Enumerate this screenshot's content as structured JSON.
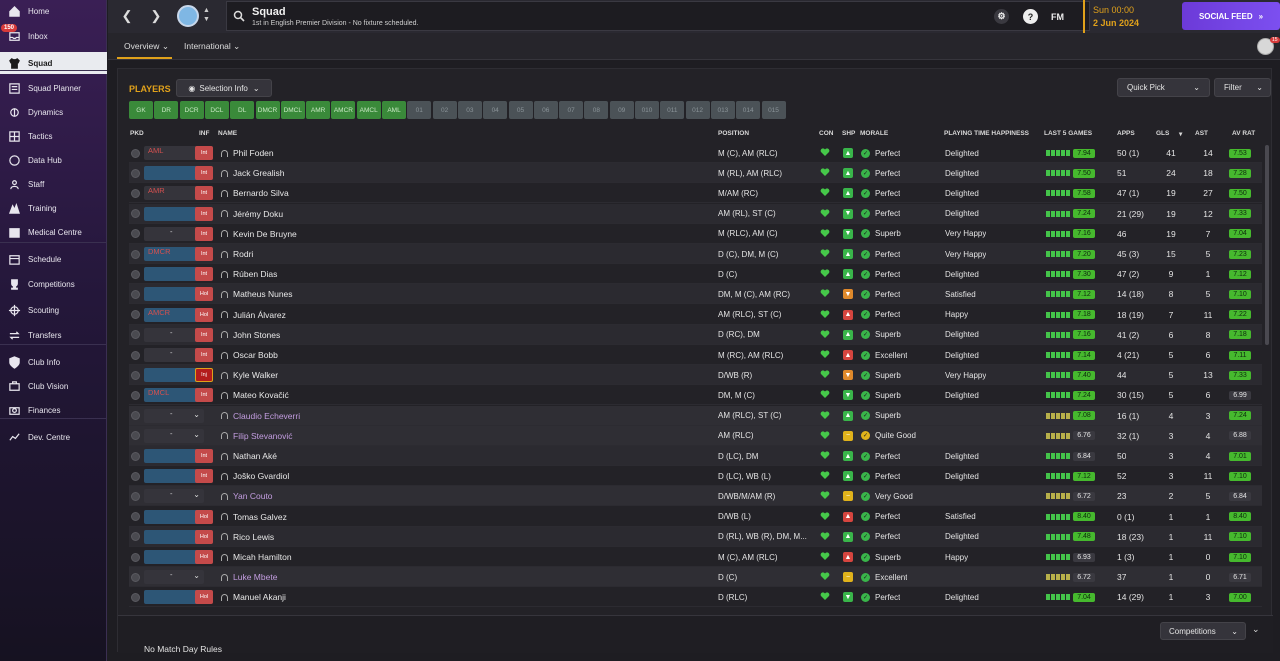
{
  "sidebar": {
    "items": [
      {
        "label": "Home",
        "icon": "home-icon"
      },
      {
        "label": "Inbox",
        "icon": "inbox-icon",
        "badge": "150"
      },
      {
        "label": "Squad",
        "icon": "shirt-icon",
        "active": true
      },
      {
        "label": "Squad Planner",
        "icon": "planner-icon"
      },
      {
        "label": "Dynamics",
        "icon": "dynamics-icon"
      },
      {
        "label": "Tactics",
        "icon": "tactics-icon"
      },
      {
        "label": "Data Hub",
        "icon": "datahub-icon"
      },
      {
        "label": "Staff",
        "icon": "staff-icon"
      },
      {
        "label": "Training",
        "icon": "training-icon"
      },
      {
        "label": "Medical Centre",
        "icon": "medical-icon"
      },
      {
        "label": "Schedule",
        "icon": "calendar-icon"
      },
      {
        "label": "Competitions",
        "icon": "trophy-icon"
      },
      {
        "label": "Scouting",
        "icon": "scouting-icon"
      },
      {
        "label": "Transfers",
        "icon": "transfers-icon"
      },
      {
        "label": "Club Info",
        "icon": "shield-icon"
      },
      {
        "label": "Club Vision",
        "icon": "vision-icon"
      },
      {
        "label": "Finances",
        "icon": "finances-icon"
      },
      {
        "label": "Dev. Centre",
        "icon": "devcentre-icon"
      }
    ]
  },
  "header": {
    "title": "Squad",
    "subtitle": "1st in English Premier Division - No fixture scheduled.",
    "fm_label": "FM",
    "help_label": "?",
    "date_day": "Sun 00:00",
    "date": "2 Jun 2024",
    "social_feed": "SOCIAL FEED",
    "avatar_badge": "15"
  },
  "tabs": [
    {
      "label": "Overview"
    },
    {
      "label": "International"
    }
  ],
  "players_panel": {
    "title": "PLAYERS",
    "selection_info": "Selection Info",
    "quick_pick": "Quick Pick",
    "filter": "Filter",
    "position_filters_on": [
      "GK",
      "DR",
      "DCR",
      "DCL",
      "DL",
      "DMCR",
      "DMCL",
      "AMR",
      "AMCR",
      "AMCL",
      "AML"
    ],
    "position_filters_off": [
      "01",
      "02",
      "03",
      "04",
      "05",
      "06",
      "07",
      "08",
      "09",
      "010",
      "011",
      "012",
      "013",
      "014",
      "015"
    ]
  },
  "columns": {
    "pkd": "PKD",
    "inf": "INF",
    "name": "NAME",
    "position": "POSITION",
    "con": "CON",
    "shp": "SHP",
    "morale": "MORALE",
    "pth": "PLAYING TIME HAPPINESS",
    "last5": "LAST 5 GAMES",
    "apps": "APPS",
    "gls": "GLS",
    "ast": "AST",
    "avrat": "AV RAT"
  },
  "colors": {
    "accent": "#e0a11b",
    "green": "#39b54a",
    "rating_green": "#46b92e",
    "youth_name": "#c39de0"
  },
  "players": [
    {
      "pkd": "AML",
      "inf": "Int",
      "name": "Phil Foden",
      "position": "M (C), AM (RLC)",
      "shp": "up",
      "morale": "Perfect",
      "happiness": "Delighted",
      "last5": "7.94",
      "apps": "50 (1)",
      "gls": "41",
      "ast": "14",
      "avrat": "7.53",
      "youth": false
    },
    {
      "pkd": "",
      "inf": "Int",
      "name": "Jack Grealish",
      "position": "M (RL), AM (RLC)",
      "shp": "up",
      "morale": "Perfect",
      "happiness": "Delighted",
      "last5": "7.50",
      "apps": "51",
      "gls": "24",
      "ast": "18",
      "avrat": "7.28",
      "youth": false
    },
    {
      "pkd": "AMR",
      "inf": "Int",
      "name": "Bernardo Silva",
      "position": "M/AM (RC)",
      "shp": "up",
      "morale": "Perfect",
      "happiness": "Delighted",
      "last5": "7.58",
      "apps": "47 (1)",
      "gls": "19",
      "ast": "27",
      "avrat": "7.50",
      "youth": false
    },
    {
      "pkd": "",
      "inf": "Int",
      "name": "Jérémy Doku",
      "position": "AM (RL), ST (C)",
      "shp": "down",
      "morale": "Perfect",
      "happiness": "Delighted",
      "last5": "7.24",
      "apps": "21 (29)",
      "gls": "19",
      "ast": "12",
      "avrat": "7.33",
      "youth": false
    },
    {
      "pkd": "-",
      "inf": "Int",
      "name": "Kevin De Bruyne",
      "position": "M (RLC), AM (C)",
      "shp": "down",
      "morale": "Superb",
      "happiness": "Very Happy",
      "last5": "7.16",
      "apps": "46",
      "gls": "19",
      "ast": "7",
      "avrat": "7.04",
      "youth": false
    },
    {
      "pkd": "DMCR",
      "inf": "Int",
      "name": "Rodri",
      "position": "D (C), DM, M (C)",
      "shp": "up",
      "morale": "Perfect",
      "happiness": "Very Happy",
      "last5": "7.20",
      "apps": "45 (3)",
      "gls": "15",
      "ast": "5",
      "avrat": "7.23",
      "youth": false
    },
    {
      "pkd": "",
      "inf": "Int",
      "name": "Rúben Dias",
      "position": "D (C)",
      "shp": "up",
      "morale": "Perfect",
      "happiness": "Delighted",
      "last5": "7.30",
      "apps": "47 (2)",
      "gls": "9",
      "ast": "1",
      "avrat": "7.12",
      "youth": false
    },
    {
      "pkd": "",
      "inf": "Hol",
      "name": "Matheus Nunes",
      "position": "DM, M (C), AM (RC)",
      "shp": "mid",
      "morale": "Perfect",
      "happiness": "Satisfied",
      "last5": "7.12",
      "apps": "14 (18)",
      "gls": "8",
      "ast": "5",
      "avrat": "7.10",
      "youth": false
    },
    {
      "pkd": "AMCR",
      "inf": "Hol",
      "name": "Julián Álvarez",
      "position": "AM (RLC), ST (C)",
      "shp": "injury",
      "morale": "Perfect",
      "happiness": "Happy",
      "last5": "7.18",
      "apps": "18 (19)",
      "gls": "7",
      "ast": "11",
      "avrat": "7.22",
      "youth": false
    },
    {
      "pkd": "-",
      "inf": "Int",
      "name": "John Stones",
      "position": "D (RC), DM",
      "shp": "up",
      "morale": "Superb",
      "happiness": "Delighted",
      "last5": "7.16",
      "apps": "41 (2)",
      "gls": "6",
      "ast": "8",
      "avrat": "7.18",
      "youth": false
    },
    {
      "pkd": "-",
      "inf": "Int",
      "name": "Oscar Bobb",
      "position": "M (RC), AM (RLC)",
      "shp": "injury",
      "morale": "Excellent",
      "happiness": "Delighted",
      "last5": "7.14",
      "apps": "4 (21)",
      "gls": "5",
      "ast": "6",
      "avrat": "7.11",
      "youth": false
    },
    {
      "pkd": "",
      "inf": "Inj",
      "name": "Kyle Walker",
      "position": "D/WB (R)",
      "shp": "mid",
      "morale": "Superb",
      "happiness": "Very Happy",
      "last5": "7.40",
      "apps": "44",
      "gls": "5",
      "ast": "13",
      "avrat": "7.33",
      "youth": false
    },
    {
      "pkd": "DMCL",
      "inf": "Int",
      "name": "Mateo Kovačić",
      "position": "DM, M (C)",
      "shp": "down",
      "morale": "Superb",
      "happiness": "Delighted",
      "last5": "7.24",
      "apps": "30 (15)",
      "gls": "5",
      "ast": "6",
      "avrat": "6.99",
      "youth": false
    },
    {
      "pkd": "-",
      "inf": "",
      "name": "Claudio Echeverri",
      "position": "AM (RLC), ST (C)",
      "shp": "up",
      "morale": "Superb",
      "happiness": "",
      "last5": "7.08",
      "apps": "16 (1)",
      "gls": "4",
      "ast": "3",
      "avrat": "7.24",
      "youth": true
    },
    {
      "pkd": "-",
      "inf": "",
      "name": "Filip Stevanović",
      "position": "AM (RLC)",
      "shp": "neutral",
      "morale": "Quite Good",
      "happiness": "",
      "last5": "6.76",
      "apps": "32 (1)",
      "gls": "3",
      "ast": "4",
      "avrat": "6.88",
      "youth": true
    },
    {
      "pkd": "",
      "inf": "Int",
      "name": "Nathan Aké",
      "position": "D (LC), DM",
      "shp": "up",
      "morale": "Perfect",
      "happiness": "Delighted",
      "last5": "6.84",
      "apps": "50",
      "gls": "3",
      "ast": "4",
      "avrat": "7.01",
      "youth": false
    },
    {
      "pkd": "",
      "inf": "Int",
      "name": "Joško Gvardiol",
      "position": "D (LC), WB (L)",
      "shp": "up",
      "morale": "Perfect",
      "happiness": "Delighted",
      "last5": "7.12",
      "apps": "52",
      "gls": "3",
      "ast": "11",
      "avrat": "7.10",
      "youth": false
    },
    {
      "pkd": "-",
      "inf": "",
      "name": "Yan Couto",
      "position": "D/WB/M/AM (R)",
      "shp": "neutral",
      "morale": "Very Good",
      "happiness": "",
      "last5": "6.72",
      "apps": "23",
      "gls": "2",
      "ast": "5",
      "avrat": "6.84",
      "youth": true
    },
    {
      "pkd": "",
      "inf": "Hol",
      "name": "Tomas Galvez",
      "position": "D/WB (L)",
      "shp": "injury",
      "morale": "Perfect",
      "happiness": "Satisfied",
      "last5": "8.40",
      "apps": "0 (1)",
      "gls": "1",
      "ast": "1",
      "avrat": "8.40",
      "youth": false
    },
    {
      "pkd": "",
      "inf": "Hol",
      "name": "Rico Lewis",
      "position": "D (RL), WB (R), DM, M...",
      "shp": "up",
      "morale": "Perfect",
      "happiness": "Delighted",
      "last5": "7.48",
      "apps": "18 (23)",
      "gls": "1",
      "ast": "11",
      "avrat": "7.10",
      "youth": false
    },
    {
      "pkd": "",
      "inf": "Hol",
      "name": "Micah Hamilton",
      "position": "M (C), AM (RLC)",
      "shp": "injury",
      "morale": "Superb",
      "happiness": "Happy",
      "last5": "6.93",
      "apps": "1 (3)",
      "gls": "1",
      "ast": "0",
      "avrat": "7.10",
      "youth": false
    },
    {
      "pkd": "-",
      "inf": "",
      "name": "Luke Mbete",
      "position": "D (C)",
      "shp": "neutral",
      "morale": "Excellent",
      "happiness": "",
      "last5": "6.72",
      "apps": "37",
      "gls": "1",
      "ast": "0",
      "avrat": "6.71",
      "youth": true
    },
    {
      "pkd": "",
      "inf": "Hol",
      "name": "Manuel Akanji",
      "position": "D (RLC)",
      "shp": "down",
      "morale": "Perfect",
      "happiness": "Delighted",
      "last5": "7.04",
      "apps": "14 (29)",
      "gls": "1",
      "ast": "3",
      "avrat": "7.00",
      "youth": false
    }
  ],
  "footer": {
    "match_rules": "No Match Day Rules",
    "competitions": "Competitions"
  }
}
